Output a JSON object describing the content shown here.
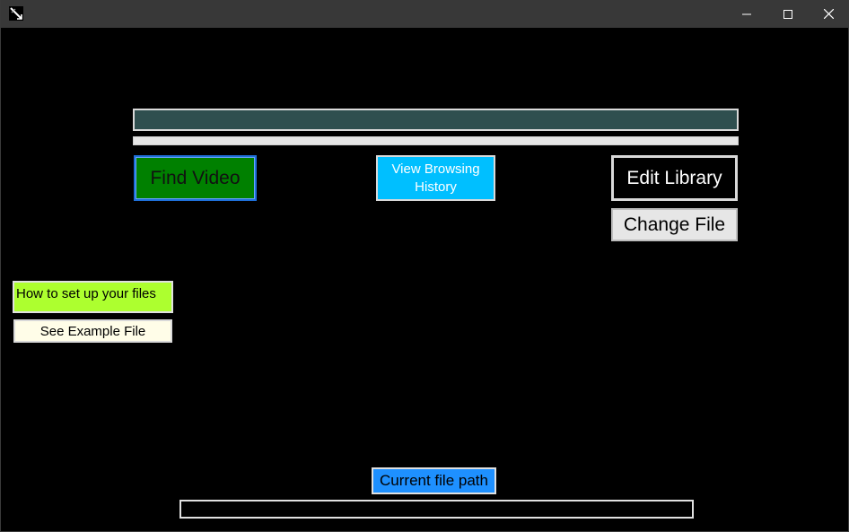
{
  "window": {
    "title": "",
    "icon": "feather-app-icon",
    "controls": {
      "minimize": "minimize-icon",
      "maximize": "maximize-icon",
      "close": "close-icon"
    }
  },
  "search": {
    "value": "",
    "placeholder": ""
  },
  "progress": {
    "fraction": 0
  },
  "buttons": {
    "find_video": "Find Video",
    "view_history": "View Browsing\nHistory",
    "edit_library": "Edit Library",
    "change_file": "Change File",
    "example_file": "See Example File"
  },
  "help": {
    "setup_label": "How to set up your files"
  },
  "file": {
    "path_label": "Current file path",
    "path_value": ""
  },
  "colors": {
    "background": "#000000",
    "titlebar": "#383838",
    "search_bg": "#2f4f4f",
    "find_video_bg": "#008000",
    "view_history_bg": "#00bfff",
    "setup_label_bg": "#adff2f",
    "example_file_bg": "#fffde8",
    "path_label_bg": "#1e90ff"
  }
}
